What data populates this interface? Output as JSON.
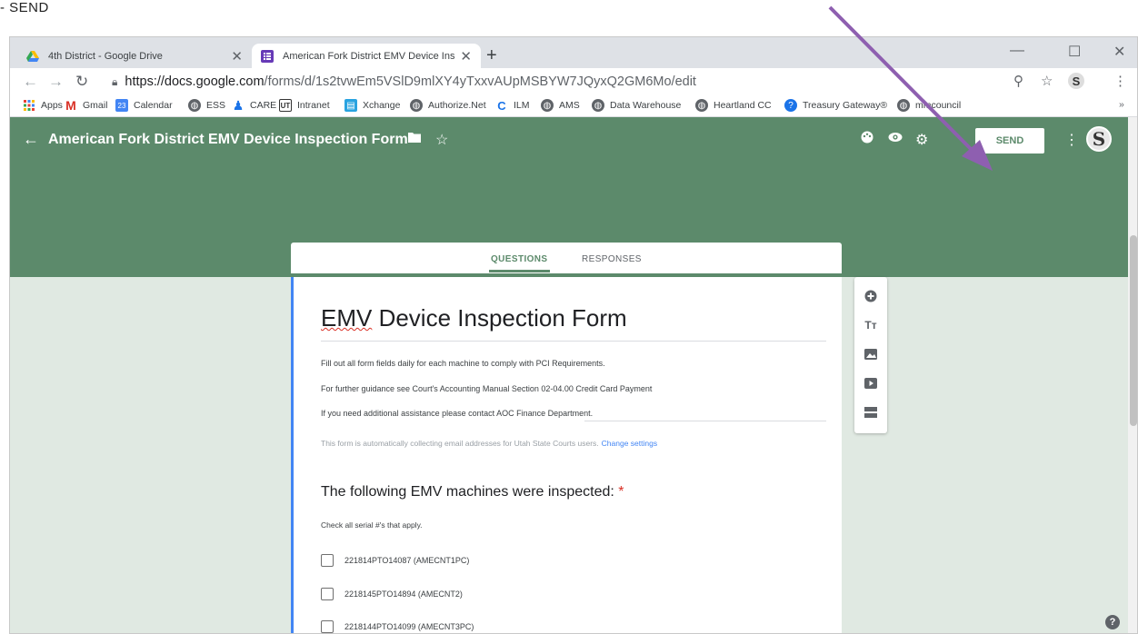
{
  "annotation": {
    "text": "- SEND"
  },
  "browser": {
    "tabs": [
      {
        "title": "4th District - Google Drive",
        "icon": "google-drive-icon"
      },
      {
        "title": "American Fork District EMV Device Insp",
        "icon": "google-forms-icon"
      }
    ],
    "url_host": "https://docs.google.com",
    "url_path": "/forms/d/1s2tvwEm5VSlD9mlXY4yTxxvAUpMSBYW7JQyxQ2GM6Mo/edit",
    "bookmarks": [
      {
        "label": "Apps"
      },
      {
        "label": "Gmail"
      },
      {
        "label": "Calendar"
      },
      {
        "label": "ESS"
      },
      {
        "label": "CARE"
      },
      {
        "label": "Intranet"
      },
      {
        "label": "Xchange"
      },
      {
        "label": "Authorize.Net"
      },
      {
        "label": "ILM"
      },
      {
        "label": "AMS"
      },
      {
        "label": "Data Warehouse"
      },
      {
        "label": "Heartland CC"
      },
      {
        "label": "Treasury Gateway®"
      },
      {
        "label": "mmcouncil"
      }
    ],
    "calendar_day": "23"
  },
  "header": {
    "title": "American Fork District EMV Device Inspection Form",
    "send_label": "SEND",
    "theme_color": "#5c8a6b"
  },
  "form_tabs": {
    "questions": "QUESTIONS",
    "responses": "RESPONSES"
  },
  "form": {
    "title_prefix": "EMV",
    "title_suffix": " Device Inspection Form",
    "description": [
      "Fill out all form fields daily for each machine to comply with PCI Requirements.",
      "For further guidance see Court's Accounting Manual Section 02-04.00  Credit Card Payment",
      "If you need additional assistance please contact AOC Finance Department."
    ],
    "email_note": "This form is automatically collecting email addresses for Utah State Courts users.",
    "change_settings": "Change settings",
    "question": "The following EMV machines were inspected:",
    "required_mark": "*",
    "help_text": "Check all serial #'s that apply.",
    "options": [
      "221814PTO14087 (AMECNT1PC)",
      "2218145PTO14894 (AMECNT2)",
      "2218144PTO14099 (AMECNT3PC)"
    ]
  }
}
